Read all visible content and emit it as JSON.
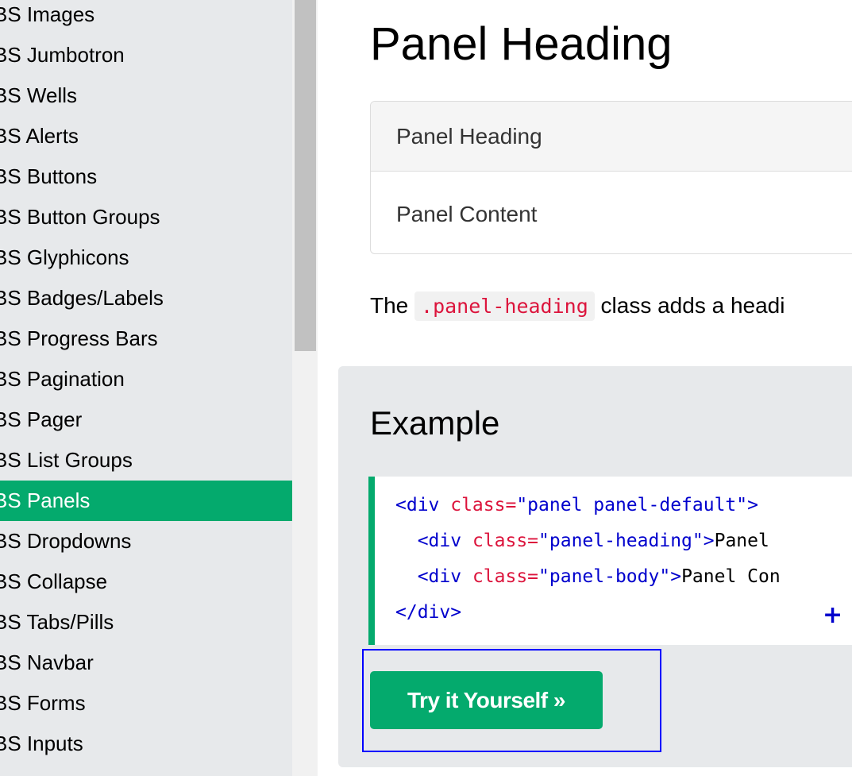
{
  "sidebar": {
    "items": [
      {
        "label": "BS Images",
        "active": false
      },
      {
        "label": "BS Jumbotron",
        "active": false
      },
      {
        "label": "BS Wells",
        "active": false
      },
      {
        "label": "BS Alerts",
        "active": false
      },
      {
        "label": "BS Buttons",
        "active": false
      },
      {
        "label": "BS Button Groups",
        "active": false
      },
      {
        "label": "BS Glyphicons",
        "active": false
      },
      {
        "label": "BS Badges/Labels",
        "active": false
      },
      {
        "label": "BS Progress Bars",
        "active": false
      },
      {
        "label": "BS Pagination",
        "active": false
      },
      {
        "label": "BS Pager",
        "active": false
      },
      {
        "label": "BS List Groups",
        "active": false
      },
      {
        "label": "BS Panels",
        "active": true
      },
      {
        "label": "BS Dropdowns",
        "active": false
      },
      {
        "label": "BS Collapse",
        "active": false
      },
      {
        "label": "BS Tabs/Pills",
        "active": false
      },
      {
        "label": "BS Navbar",
        "active": false
      },
      {
        "label": "BS Forms",
        "active": false
      },
      {
        "label": "BS Inputs",
        "active": false
      }
    ]
  },
  "main": {
    "title": "Panel Heading",
    "panel": {
      "heading": "Panel Heading",
      "body": "Panel Content"
    },
    "description": {
      "before": "The ",
      "code": ".panel-heading",
      "after": " class adds a headi"
    },
    "example": {
      "title": "Example",
      "code": {
        "line1": {
          "open": "<div",
          "attr": " class=",
          "val": "\"panel panel-default\"",
          "close": ">"
        },
        "line2": {
          "indent": "  ",
          "open": "<div",
          "attr": " class=",
          "val": "\"panel-heading\"",
          "close": ">",
          "text": "Panel"
        },
        "line3": {
          "indent": "  ",
          "open": "<div",
          "attr": " class=",
          "val": "\"panel-body\"",
          "close": ">",
          "text": "Panel Con"
        },
        "line4": {
          "close": "</div>"
        }
      },
      "expand_symbol": "+",
      "try_button_label": "Try it Yourself »"
    }
  },
  "colors": {
    "accent": "#04aa6d",
    "sidebar_bg": "#e7e9eb",
    "highlight": "#0000ff",
    "code_tag": "#0000cd",
    "code_attr": "#dc143c"
  }
}
